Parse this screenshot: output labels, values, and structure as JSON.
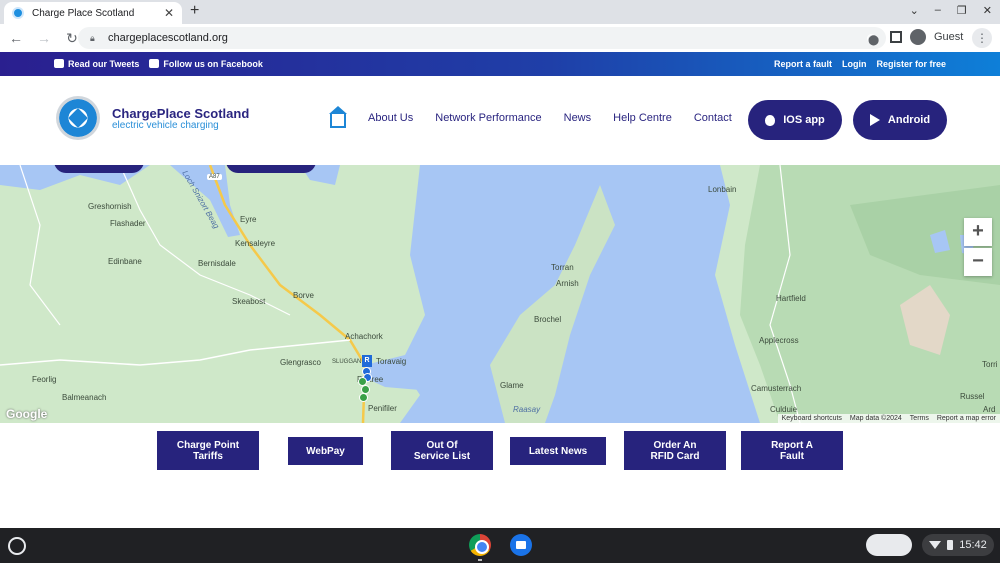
{
  "browser": {
    "tab_title": "Charge Place Scotland",
    "url": "chargeplacescotland.org",
    "profile": "Guest",
    "window_controls": [
      "⌄",
      "–",
      "❐",
      "✕"
    ]
  },
  "social_bar": {
    "tweets": "Read our Tweets",
    "facebook": "Follow us on Facebook",
    "report_fault": "Report a fault",
    "login": "Login",
    "register": "Register for free"
  },
  "brand": {
    "name": "ChargePlace Scotland",
    "tagline": "electric vehicle charging"
  },
  "nav": {
    "items": [
      "About Us",
      "Network Performance",
      "News",
      "Help Centre",
      "Contact"
    ],
    "ios": "IOS app",
    "android": "Android"
  },
  "map": {
    "labels": {
      "lonbain": "Lonbain",
      "greshornish": "Greshornish",
      "flashader": "Flashader",
      "eyre": "Eyre",
      "kensaleyre": "Kensaleyre",
      "edinbane": "Edinbane",
      "bernisdale": "Bernisdale",
      "skeabost": "Skeabost",
      "borve": "Borve",
      "achachork": "Achachork",
      "glengrasco": "Glengrasco",
      "sluggan": "SLUGGAN",
      "toravaig": "Toravaig",
      "portree": "Portree",
      "feorlig": "Feorlig",
      "balmeanach": "Balmeanach",
      "penifiler": "Penifiler",
      "torran": "Torran",
      "arnish": "Arnish",
      "brochel": "Brochel",
      "glame": "Glame",
      "raasay": "Raasay",
      "hartfield": "Hartfield",
      "applecross": "Applecross",
      "camusterrach": "Camusterrach",
      "culduie": "Culduie",
      "russel": "Russel",
      "torri": "Torri",
      "ard": "Ard",
      "loch_snizort": "Loch Snizort Beag",
      "road": "A87"
    },
    "pin_label": "R",
    "google": "Google",
    "attribution": [
      "Keyboard shortcuts",
      "Map data ©2024",
      "Terms",
      "Report a map error"
    ],
    "zoom_in": "+",
    "zoom_out": "−"
  },
  "quick_links": [
    {
      "line1": "Charge Point",
      "line2": "Tariffs"
    },
    {
      "line1": "WebPay",
      "line2": ""
    },
    {
      "line1": "Out Of",
      "line2": "Service List"
    },
    {
      "line1": "Latest News",
      "line2": ""
    },
    {
      "line1": "Order An",
      "line2": "RFID Card"
    },
    {
      "line1": "Report A",
      "line2": "Fault"
    }
  ],
  "taskbar": {
    "time": "15:42"
  }
}
